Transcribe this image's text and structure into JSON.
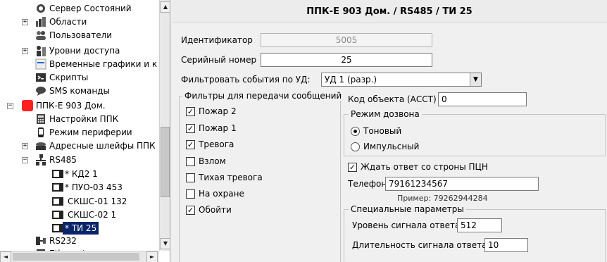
{
  "tree": {
    "items": [
      {
        "label": "Сервер Состояний",
        "icon": "server-state-icon"
      },
      {
        "label": "Области",
        "icon": "areas-icon"
      },
      {
        "label": "Пользователи",
        "icon": "users-icon"
      },
      {
        "label": "Уровни доступа",
        "icon": "access-levels-icon"
      },
      {
        "label": "Временные графики и к",
        "icon": "schedule-icon"
      },
      {
        "label": "Скрипты",
        "icon": "scripts-icon"
      },
      {
        "label": "SMS команды",
        "icon": "sms-icon"
      },
      {
        "label": "ППК-Е 903 Дом.",
        "icon": "device-red-icon"
      },
      {
        "label": "Настройки ППК",
        "icon": "calculator-icon"
      },
      {
        "label": "Режим периферии",
        "icon": "phone-icon"
      },
      {
        "label": "Адресные шлейфы ППК",
        "icon": "loops-icon"
      },
      {
        "label": "RS485",
        "icon": "rs485-icon"
      },
      {
        "label": "* КД2 1",
        "icon": "module-icon"
      },
      {
        "label": "* ПУО-03 453",
        "icon": "module-icon"
      },
      {
        "label": "СКШС-01 132",
        "icon": "module-icon"
      },
      {
        "label": "СКШС-02 1",
        "icon": "module-icon"
      },
      {
        "label": "* ТИ 25",
        "icon": "module-icon"
      },
      {
        "label": "RS232",
        "icon": "rs232-icon"
      },
      {
        "label": "Ethernet",
        "icon": "ethernet-icon"
      }
    ],
    "expanders": {
      "plus": "+",
      "minus": "−"
    }
  },
  "title": "ППК-Е 903 Дом. / RS485 / ТИ 25",
  "form": {
    "identifier_label": "Идентификатор",
    "identifier_value": "5005",
    "serial_label": "Серийный номер",
    "serial_value": "25",
    "filter_label": "Фильтровать события по УД:",
    "filter_value": "УД 1 (разр.)"
  },
  "filters": {
    "title": "Фильтры для передачи сообщений",
    "items": [
      {
        "label": "Пожар 2",
        "checked": true,
        "mark": "✓"
      },
      {
        "label": "Пожар 1",
        "checked": true,
        "mark": "✓"
      },
      {
        "label": "Тревога",
        "checked": true,
        "mark": "✓"
      },
      {
        "label": "Взлом",
        "checked": false,
        "mark": ""
      },
      {
        "label": "Тихая тревога",
        "checked": false,
        "mark": ""
      },
      {
        "label": "На охране",
        "checked": false,
        "mark": ""
      },
      {
        "label": "Обойти",
        "checked": true,
        "mark": "✓"
      }
    ]
  },
  "object_code": {
    "label": "Код объекта (АССТ)",
    "value": "0"
  },
  "dial_mode": {
    "title": "Режим дозвона",
    "options": [
      {
        "label": "Тоновый",
        "selected": true
      },
      {
        "label": "Импульсный",
        "selected": false
      }
    ]
  },
  "wait_answer": {
    "label": "Ждать ответ со строны ПЦН",
    "checked": true,
    "mark": "✓"
  },
  "phone": {
    "label": "Телефон",
    "value": "79161234567",
    "hint": "Пример: 79262944284"
  },
  "special": {
    "title": "Специальные параметры",
    "level_label": "Уровень сигнала ответа",
    "level_value": "512",
    "duration_label": "Длительность сигнала ответа",
    "duration_value": "10"
  },
  "scroll": {
    "up": "▲",
    "down": "▼",
    "left": "◄",
    "right": "►",
    "combo": "▼"
  },
  "colors": {
    "selection": "#0a246a",
    "device_red": "#ff2020"
  }
}
